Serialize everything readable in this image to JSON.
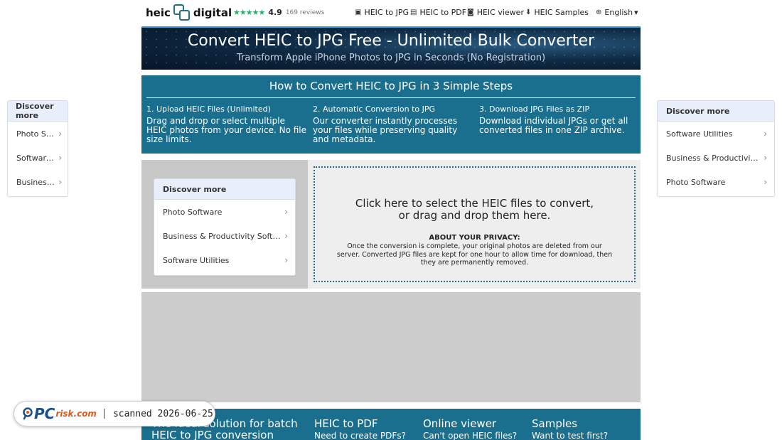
{
  "header": {
    "logo_left": "heic",
    "logo_right": "digital",
    "rating_stars": "★★★★★",
    "rating_score": "4.9",
    "rating_count": "169 reviews",
    "nav": [
      {
        "icon": "image-icon",
        "label": "HEIC to JPG"
      },
      {
        "icon": "file-icon",
        "label": "HEIC to PDF"
      },
      {
        "icon": "viewer-icon",
        "label": "HEIC viewer"
      },
      {
        "icon": "download-icon",
        "label": "HEIC Samples"
      }
    ],
    "language": "English"
  },
  "hero": {
    "title": "Convert HEIC to JPG Free - Unlimited Bulk Converter",
    "subtitle": "Transform Apple iPhone Photos to JPG in Seconds (No Registration)"
  },
  "steps": {
    "heading": "How to Convert HEIC to JPG in 3 Simple Steps",
    "items": [
      {
        "title": "1. Upload HEIC Files (Unlimited)",
        "desc": "Drag and drop or select multiple HEIC photos from your device. No file size limits."
      },
      {
        "title": "2. Automatic Conversion to JPG",
        "desc": "Our converter instantly processes your files while preserving quality and metadata."
      },
      {
        "title": "3. Download JPG Files as ZIP",
        "desc": "Download individual JPGs or get all converted files in one ZIP archive."
      }
    ]
  },
  "discover_left": {
    "heading": "Discover more",
    "items": [
      "Photo Software",
      "Software Utilities",
      "Business & Productivity Software"
    ]
  },
  "discover_right": {
    "heading": "Discover more",
    "items": [
      "Software Utilities",
      "Business & Productivity Software",
      "Photo Software"
    ]
  },
  "discover_center": {
    "heading": "Discover more",
    "items": [
      "Photo Software",
      "Business & Productivity Software",
      "Software Utilities"
    ]
  },
  "upload": {
    "line1": "Click here to select the HEIC files to convert,",
    "line2": "or drag and drop them here.",
    "privacy_title": "ABOUT YOUR PRIVACY:",
    "privacy_text": "Once the conversion is complete, your original photos are deleted from our server. Converted JPG files are kept for one hour to allow time for download, then they are permanently removed."
  },
  "footer": {
    "cols": [
      {
        "title": "The ideal solution for batch HEIC to JPG conversion",
        "sub": ""
      },
      {
        "title": "HEIC to PDF",
        "sub": "Need to create PDFs?"
      },
      {
        "title": "Online viewer",
        "sub": "Can't open HEIC files?"
      },
      {
        "title": "Samples",
        "sub": "Want to test first?"
      }
    ]
  },
  "watermark": {
    "brand_p": "P",
    "brand_c": "C",
    "brand_rest": "risk.com",
    "stamp": "scanned 2026-06-25"
  }
}
